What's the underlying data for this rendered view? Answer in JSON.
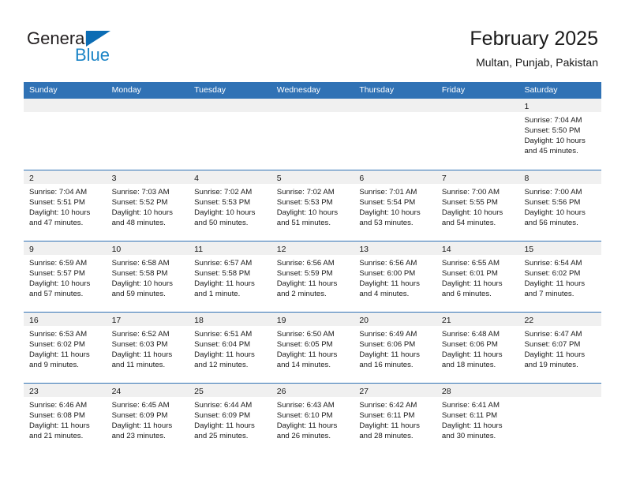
{
  "brand": {
    "name_part1": "General",
    "name_part2": "Blue",
    "triangle_icon": "blue-triangle-icon",
    "accent_color": "#1b84c6",
    "dark_color": "#231f20"
  },
  "header": {
    "title": "February 2025",
    "subtitle": "Multan, Punjab, Pakistan",
    "header_bg_color": "#3072b5",
    "daynum_strip_color": "#f0f0f0"
  },
  "weekdays": [
    "Sunday",
    "Monday",
    "Tuesday",
    "Wednesday",
    "Thursday",
    "Friday",
    "Saturday"
  ],
  "labels": {
    "sunrise_prefix": "Sunrise:",
    "sunset_prefix": "Sunset:",
    "daylight_prefix": "Daylight:"
  },
  "weeks": [
    [
      {
        "day": "",
        "empty": true
      },
      {
        "day": "",
        "empty": true
      },
      {
        "day": "",
        "empty": true
      },
      {
        "day": "",
        "empty": true
      },
      {
        "day": "",
        "empty": true
      },
      {
        "day": "",
        "empty": true
      },
      {
        "day": "1",
        "sunrise": "Sunrise: 7:04 AM",
        "sunset": "Sunset: 5:50 PM",
        "daylight": "Daylight: 10 hours and 45 minutes."
      }
    ],
    [
      {
        "day": "2",
        "sunrise": "Sunrise: 7:04 AM",
        "sunset": "Sunset: 5:51 PM",
        "daylight": "Daylight: 10 hours and 47 minutes."
      },
      {
        "day": "3",
        "sunrise": "Sunrise: 7:03 AM",
        "sunset": "Sunset: 5:52 PM",
        "daylight": "Daylight: 10 hours and 48 minutes."
      },
      {
        "day": "4",
        "sunrise": "Sunrise: 7:02 AM",
        "sunset": "Sunset: 5:53 PM",
        "daylight": "Daylight: 10 hours and 50 minutes."
      },
      {
        "day": "5",
        "sunrise": "Sunrise: 7:02 AM",
        "sunset": "Sunset: 5:53 PM",
        "daylight": "Daylight: 10 hours and 51 minutes."
      },
      {
        "day": "6",
        "sunrise": "Sunrise: 7:01 AM",
        "sunset": "Sunset: 5:54 PM",
        "daylight": "Daylight: 10 hours and 53 minutes."
      },
      {
        "day": "7",
        "sunrise": "Sunrise: 7:00 AM",
        "sunset": "Sunset: 5:55 PM",
        "daylight": "Daylight: 10 hours and 54 minutes."
      },
      {
        "day": "8",
        "sunrise": "Sunrise: 7:00 AM",
        "sunset": "Sunset: 5:56 PM",
        "daylight": "Daylight: 10 hours and 56 minutes."
      }
    ],
    [
      {
        "day": "9",
        "sunrise": "Sunrise: 6:59 AM",
        "sunset": "Sunset: 5:57 PM",
        "daylight": "Daylight: 10 hours and 57 minutes."
      },
      {
        "day": "10",
        "sunrise": "Sunrise: 6:58 AM",
        "sunset": "Sunset: 5:58 PM",
        "daylight": "Daylight: 10 hours and 59 minutes."
      },
      {
        "day": "11",
        "sunrise": "Sunrise: 6:57 AM",
        "sunset": "Sunset: 5:58 PM",
        "daylight": "Daylight: 11 hours and 1 minute."
      },
      {
        "day": "12",
        "sunrise": "Sunrise: 6:56 AM",
        "sunset": "Sunset: 5:59 PM",
        "daylight": "Daylight: 11 hours and 2 minutes."
      },
      {
        "day": "13",
        "sunrise": "Sunrise: 6:56 AM",
        "sunset": "Sunset: 6:00 PM",
        "daylight": "Daylight: 11 hours and 4 minutes."
      },
      {
        "day": "14",
        "sunrise": "Sunrise: 6:55 AM",
        "sunset": "Sunset: 6:01 PM",
        "daylight": "Daylight: 11 hours and 6 minutes."
      },
      {
        "day": "15",
        "sunrise": "Sunrise: 6:54 AM",
        "sunset": "Sunset: 6:02 PM",
        "daylight": "Daylight: 11 hours and 7 minutes."
      }
    ],
    [
      {
        "day": "16",
        "sunrise": "Sunrise: 6:53 AM",
        "sunset": "Sunset: 6:02 PM",
        "daylight": "Daylight: 11 hours and 9 minutes."
      },
      {
        "day": "17",
        "sunrise": "Sunrise: 6:52 AM",
        "sunset": "Sunset: 6:03 PM",
        "daylight": "Daylight: 11 hours and 11 minutes."
      },
      {
        "day": "18",
        "sunrise": "Sunrise: 6:51 AM",
        "sunset": "Sunset: 6:04 PM",
        "daylight": "Daylight: 11 hours and 12 minutes."
      },
      {
        "day": "19",
        "sunrise": "Sunrise: 6:50 AM",
        "sunset": "Sunset: 6:05 PM",
        "daylight": "Daylight: 11 hours and 14 minutes."
      },
      {
        "day": "20",
        "sunrise": "Sunrise: 6:49 AM",
        "sunset": "Sunset: 6:06 PM",
        "daylight": "Daylight: 11 hours and 16 minutes."
      },
      {
        "day": "21",
        "sunrise": "Sunrise: 6:48 AM",
        "sunset": "Sunset: 6:06 PM",
        "daylight": "Daylight: 11 hours and 18 minutes."
      },
      {
        "day": "22",
        "sunrise": "Sunrise: 6:47 AM",
        "sunset": "Sunset: 6:07 PM",
        "daylight": "Daylight: 11 hours and 19 minutes."
      }
    ],
    [
      {
        "day": "23",
        "sunrise": "Sunrise: 6:46 AM",
        "sunset": "Sunset: 6:08 PM",
        "daylight": "Daylight: 11 hours and 21 minutes."
      },
      {
        "day": "24",
        "sunrise": "Sunrise: 6:45 AM",
        "sunset": "Sunset: 6:09 PM",
        "daylight": "Daylight: 11 hours and 23 minutes."
      },
      {
        "day": "25",
        "sunrise": "Sunrise: 6:44 AM",
        "sunset": "Sunset: 6:09 PM",
        "daylight": "Daylight: 11 hours and 25 minutes."
      },
      {
        "day": "26",
        "sunrise": "Sunrise: 6:43 AM",
        "sunset": "Sunset: 6:10 PM",
        "daylight": "Daylight: 11 hours and 26 minutes."
      },
      {
        "day": "27",
        "sunrise": "Sunrise: 6:42 AM",
        "sunset": "Sunset: 6:11 PM",
        "daylight": "Daylight: 11 hours and 28 minutes."
      },
      {
        "day": "28",
        "sunrise": "Sunrise: 6:41 AM",
        "sunset": "Sunset: 6:11 PM",
        "daylight": "Daylight: 11 hours and 30 minutes."
      },
      {
        "day": "",
        "empty": true
      }
    ]
  ]
}
